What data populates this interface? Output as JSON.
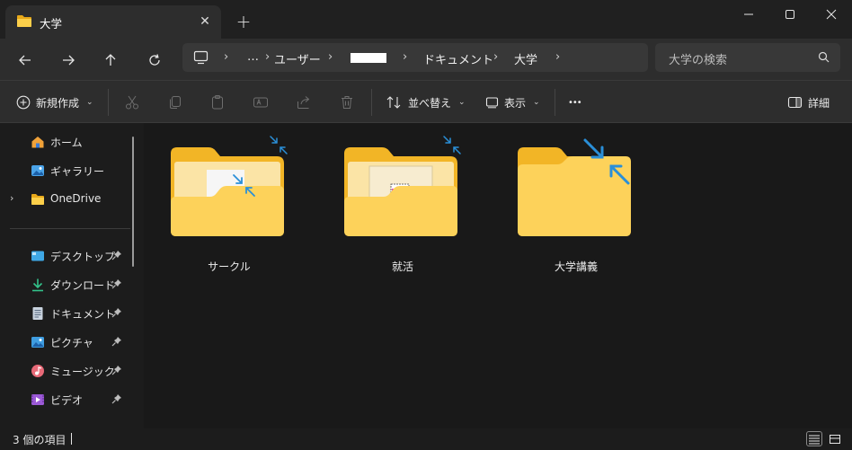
{
  "tab": {
    "title": "大学",
    "close_icon": "close-icon",
    "new_tab_label": "+"
  },
  "window_controls": {
    "minimize": "minimize-icon",
    "maximize": "maximize-icon",
    "close": "close-icon"
  },
  "nav_buttons": [
    "back-arrow-icon",
    "forward-arrow-icon",
    "up-arrow-icon",
    "refresh-icon"
  ],
  "breadcrumb": {
    "overflow": "…",
    "items": [
      "ユーザー",
      "ドキュメント",
      "大学"
    ]
  },
  "search": {
    "placeholder": "大学の検索"
  },
  "commandbar": {
    "new_label": "新規作成",
    "sort_label": "並べ替え",
    "view_label": "表示",
    "more_label": "•••",
    "details_label": "詳細"
  },
  "sidebar": {
    "items": [
      {
        "label": "ホーム",
        "icon": "home-icon"
      },
      {
        "label": "ギャラリー",
        "icon": "gallery-icon"
      },
      {
        "label": "OneDrive",
        "icon": "folder-icon"
      },
      {
        "label": "デスクトップ",
        "icon": "desktop-icon",
        "pinned": true
      },
      {
        "label": "ダウンロード",
        "icon": "download-icon",
        "pinned": true
      },
      {
        "label": "ドキュメント",
        "icon": "documents-icon",
        "pinned": true
      },
      {
        "label": "ピクチャ",
        "icon": "pictures-icon",
        "pinned": true
      },
      {
        "label": "ミュージック",
        "icon": "music-icon",
        "pinned": true
      },
      {
        "label": "ビデオ",
        "icon": "video-icon",
        "pinned": true
      }
    ]
  },
  "folders": [
    {
      "name": "サークル",
      "compressed": true
    },
    {
      "name": "就活",
      "compressed": true
    },
    {
      "name": "大学講義",
      "compressed": true
    }
  ],
  "status": {
    "item_count": "3 個の項目"
  },
  "colors": {
    "accent_blue": "#2a8fd8",
    "folder_yellow": "#f8c93a",
    "background": "#1c1c1c"
  }
}
